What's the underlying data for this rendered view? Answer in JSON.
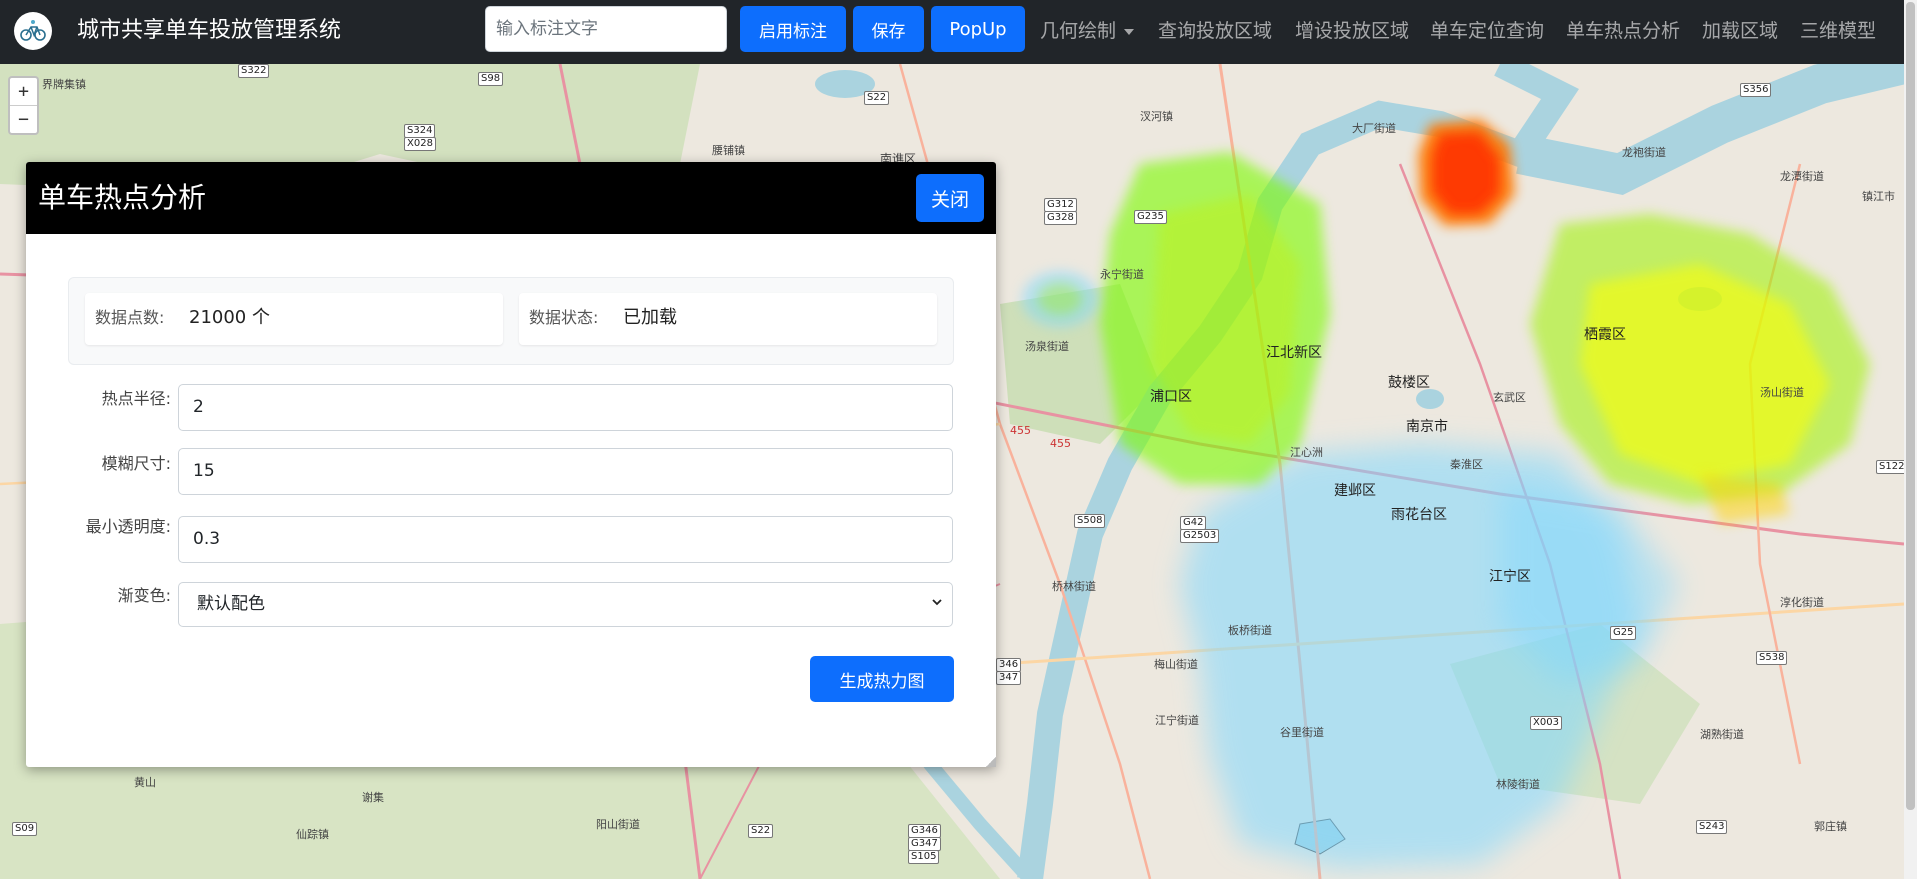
{
  "app": {
    "title": "城市共享单车投放管理系统"
  },
  "toolbar": {
    "search_placeholder": "输入标注文字",
    "search_value": "",
    "enable_label_button": "启用标注",
    "save_button": "保存",
    "popup_button": "PopUp"
  },
  "nav": {
    "items": [
      {
        "label": "几何绘制",
        "dropdown": true
      },
      {
        "label": "查询投放区域"
      },
      {
        "label": "增设投放区域"
      },
      {
        "label": "单车定位查询"
      },
      {
        "label": "单车热点分析"
      },
      {
        "label": "加载区域"
      },
      {
        "label": "三维模型"
      }
    ]
  },
  "map": {
    "zoom_in": "+",
    "zoom_out": "−",
    "place_labels": [
      "界牌集镇",
      "腰铺镇",
      "南谯区",
      "汊河镇",
      "大厂街道",
      "龙袍街道",
      "龙潭街道",
      "镇江市",
      "永宁街道",
      "江北新区",
      "汤泉街道",
      "浦口区",
      "鼓楼区",
      "玄武区",
      "南京市",
      "栖霞区",
      "江心洲",
      "建邺区",
      "秦淮区",
      "雨花台区",
      "汤山街道",
      "江宁区",
      "桥林街道",
      "板桥街道",
      "梅山街道",
      "江宁街道",
      "谷里街道",
      "湖熟街道",
      "淳化街道",
      "林陵街道",
      "黄山",
      "谢集",
      "仙踪镇",
      "郭庄镇",
      "阳山街道"
    ],
    "road_badges": [
      "S322",
      "S98",
      "S22",
      "S324",
      "X028",
      "G312",
      "G328",
      "G235",
      "S356",
      "S508",
      "G42",
      "G2503",
      "S122",
      "S538",
      "S243",
      "G25",
      "X003",
      "S22",
      "G346",
      "G347",
      "S105",
      "S09",
      "346",
      "347",
      "455",
      "455"
    ]
  },
  "panel": {
    "title": "单车热点分析",
    "close_button": "关闭",
    "stats": {
      "points_label": "数据点数:",
      "points_value": "21000 个",
      "status_label": "数据状态:",
      "status_value": "已加载"
    },
    "fields": {
      "radius_label": "热点半径:",
      "radius_value": "2",
      "blur_label": "模糊尺寸:",
      "blur_value": "15",
      "opacity_label": "最小透明度:",
      "opacity_value": "0.3",
      "gradient_label": "渐变色:",
      "gradient_value": "默认配色"
    },
    "generate_button": "生成热力图"
  },
  "colors": {
    "navbar_bg": "#212529",
    "primary": "#0d6efd",
    "modal_header_bg": "#000000",
    "heat_low": "#7fd8ff",
    "heat_mid": "#7cfc00",
    "heat_high": "#ffff00",
    "heat_max": "#ff3300"
  }
}
